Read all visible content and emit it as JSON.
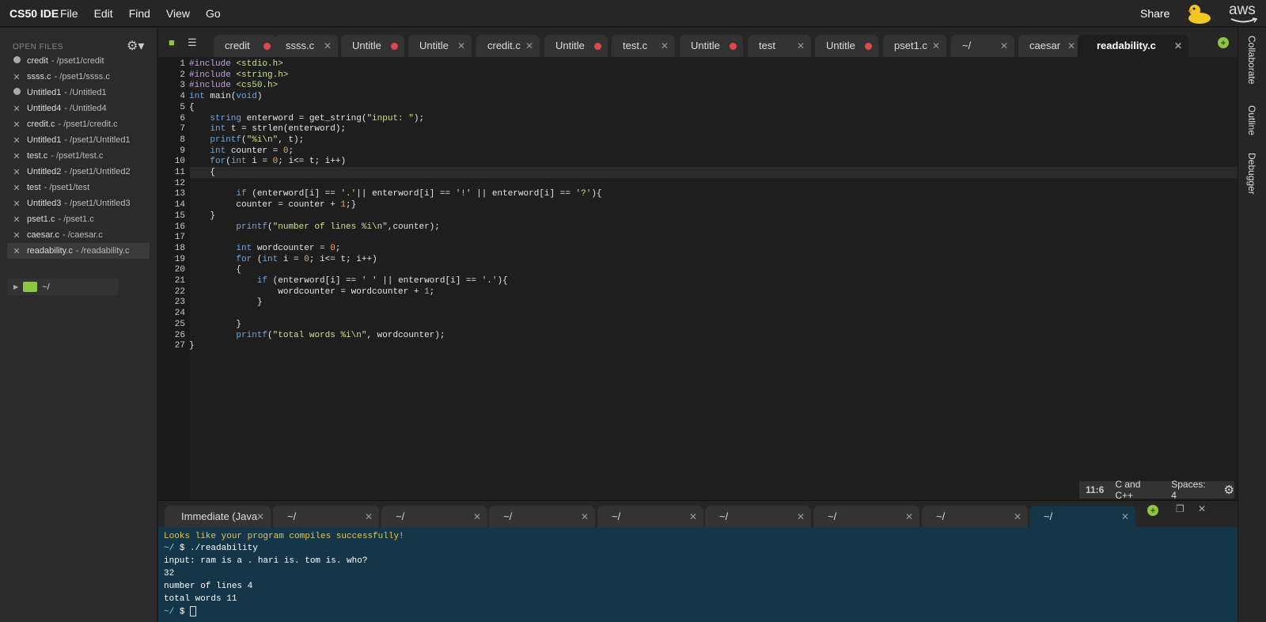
{
  "app": {
    "brand": "CS50 IDE",
    "menus": [
      "File",
      "Edit",
      "Find",
      "View",
      "Go"
    ],
    "share": "Share",
    "aws": "aws"
  },
  "sidebar": {
    "title": "OPEN FILES",
    "files": [
      {
        "name": "credit",
        "path": "- /pset1/credit",
        "mark": "dot"
      },
      {
        "name": "ssss.c",
        "path": "- /pset1/ssss.c",
        "mark": "x"
      },
      {
        "name": "Untitled1",
        "path": "- /Untitled1",
        "mark": "dot"
      },
      {
        "name": "Untitled4",
        "path": "- /Untitled4",
        "mark": "x"
      },
      {
        "name": "credit.c",
        "path": "- /pset1/credit.c",
        "mark": "x"
      },
      {
        "name": "Untitled1",
        "path": "- /pset1/Untitled1",
        "mark": "x"
      },
      {
        "name": "test.c",
        "path": "- /pset1/test.c",
        "mark": "x"
      },
      {
        "name": "Untitled2",
        "path": "- /pset1/Untitled2",
        "mark": "x"
      },
      {
        "name": "test",
        "path": "- /pset1/test",
        "mark": "x"
      },
      {
        "name": "Untitled3",
        "path": "- /pset1/Untitled3",
        "mark": "x"
      },
      {
        "name": "pset1.c",
        "path": "- /pset1.c",
        "mark": "x"
      },
      {
        "name": "caesar.c",
        "path": "- /caesar.c",
        "mark": "x"
      },
      {
        "name": "readability.c",
        "path": "- /readability.c",
        "mark": "x",
        "selected": true
      }
    ],
    "tree_root": "~/"
  },
  "editor_tabs": [
    {
      "label": "credit",
      "status": "unsaved"
    },
    {
      "label": "ssss.c",
      "status": "close"
    },
    {
      "label": "Untitle",
      "status": "unsaved"
    },
    {
      "label": "Untitle",
      "status": "close"
    },
    {
      "label": "credit.c",
      "status": "close"
    },
    {
      "label": "Untitle",
      "status": "unsaved"
    },
    {
      "label": "test.c",
      "status": "close"
    },
    {
      "label": "Untitle",
      "status": "unsaved"
    },
    {
      "label": "test",
      "status": "close"
    },
    {
      "label": "Untitle",
      "status": "unsaved"
    },
    {
      "label": "pset1.c",
      "status": "close"
    },
    {
      "label": "~/",
      "status": "close"
    },
    {
      "label": "caesar",
      "status": "close"
    },
    {
      "label": "readability.c",
      "status": "close",
      "active": true
    }
  ],
  "right_panel": [
    "Collaborate",
    "Outline",
    "Debugger"
  ],
  "code_lines": [
    "#include <stdio.h>",
    "#include <string.h>",
    "#include <cs50.h>",
    "int main(void)",
    "{",
    "    string enterword = get_string(\"input: \");",
    "    int t = strlen(enterword);",
    "    printf(\"%i\\n\", t);",
    "    int counter = 0;",
    "    for(int i = 0; i<= t; i++)",
    "    {",
    "",
    "         if (enterword[i] == '.'|| enterword[i] == '!' || enterword[i] == '?'){",
    "         counter = counter + 1;}",
    "    }",
    "         printf(\"number of lines %i\\n\",counter);",
    "",
    "         int wordcounter = 0;",
    "         for (int i = 0; i<= t; i++)",
    "         {",
    "             if (enterword[i] == ' ' || enterword[i] == '.'){",
    "                 wordcounter = wordcounter + 1;",
    "             }",
    "",
    "         }",
    "         printf(\"total words %i\\n\", wordcounter);",
    "}"
  ],
  "status": {
    "position": "11:6",
    "language": "C and C++",
    "spaces": "Spaces: 4"
  },
  "terminal_tabs": [
    "Immediate (Java",
    "~/",
    "~/",
    "~/",
    "~/",
    "~/",
    "~/",
    "~/",
    "~/"
  ],
  "terminal": {
    "l1": "Looks like your program compiles successfully!",
    "prompt": "~/",
    "cmd": "$ ./readability",
    "l3": "input: ram is a . hari is. tom is. who?",
    "l4": "32",
    "l5": "number of lines 4",
    "l6": "total words 11",
    "last_prompt": "~/",
    "last_dollar": "$"
  },
  "colors": {
    "accent_green": "#8dc63f",
    "unsaved_red": "#e0474c",
    "terminal_bg": "#153548",
    "warning_yellow": "#e6c84a"
  }
}
